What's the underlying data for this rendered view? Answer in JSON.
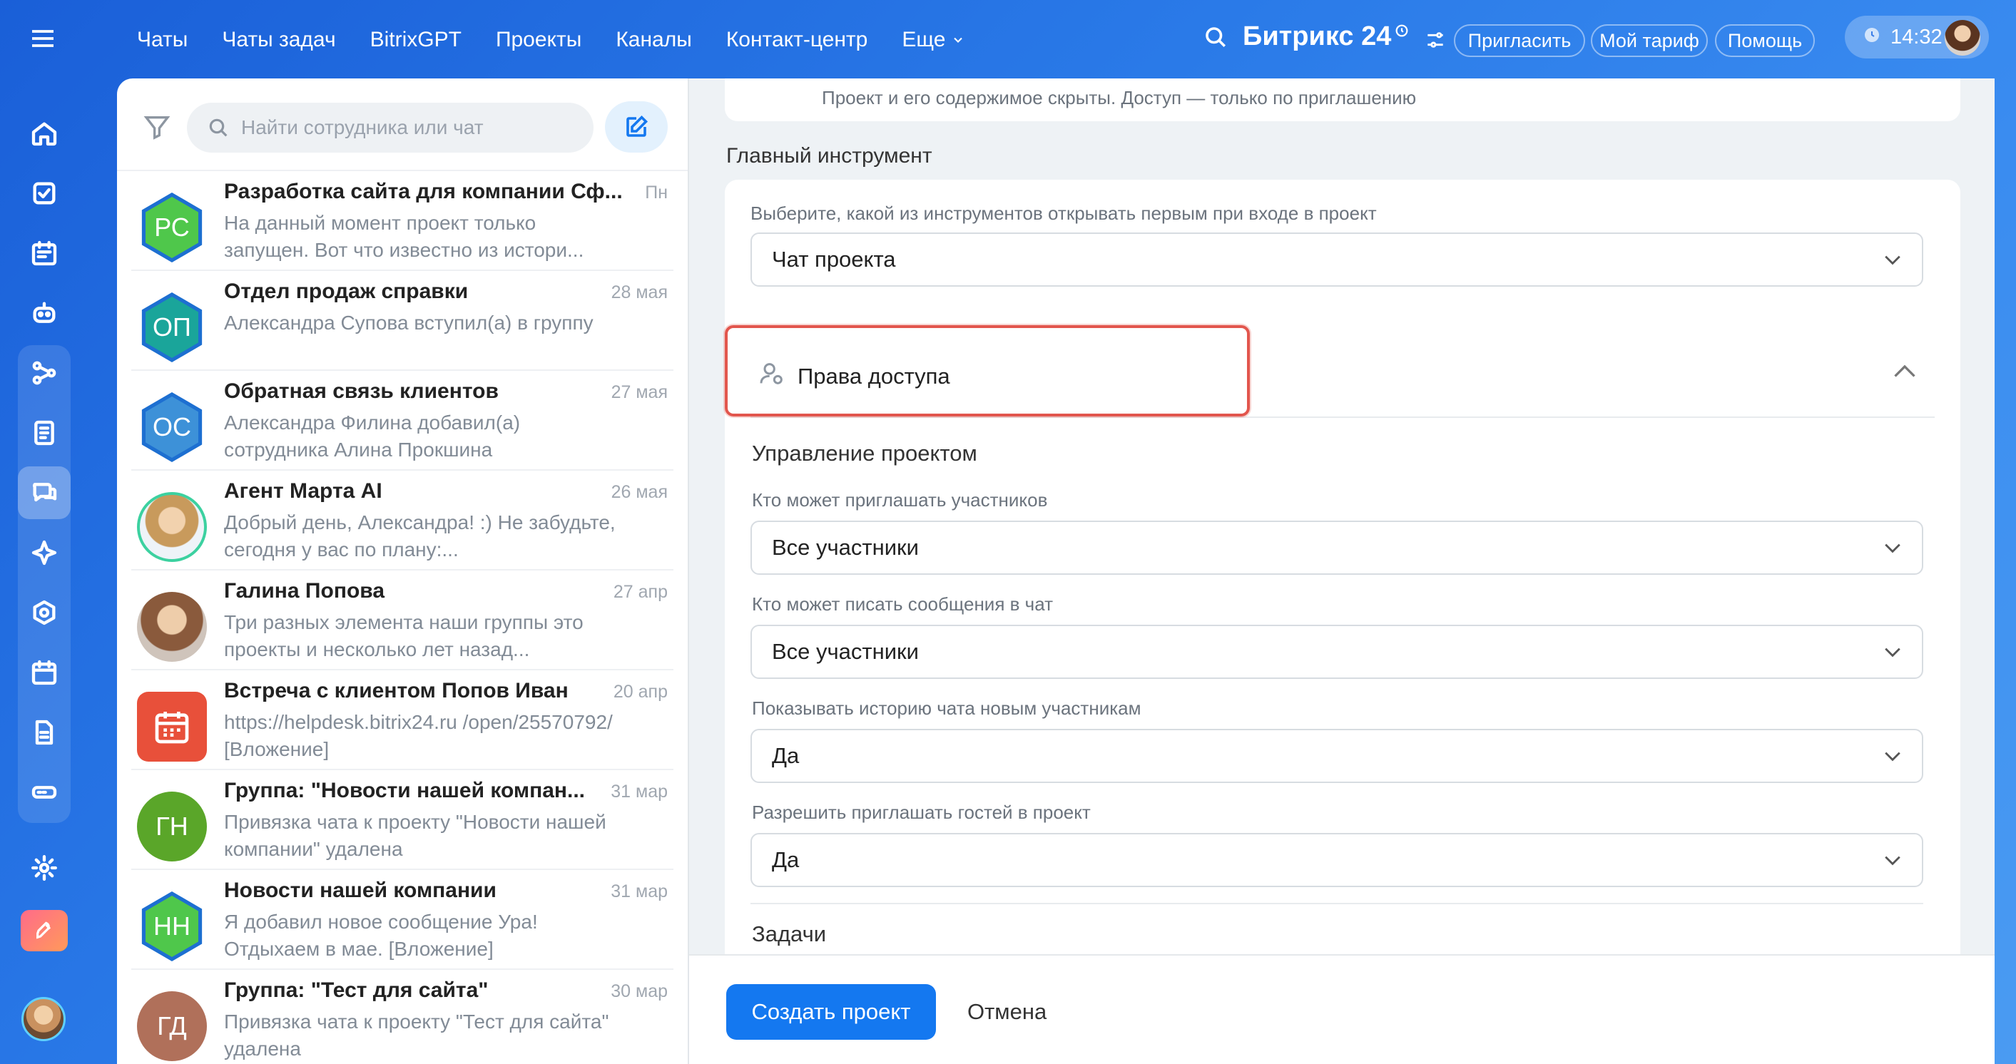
{
  "topbar": {
    "nav": [
      "Чаты",
      "Чаты задач",
      "BitrixGPT",
      "Проекты",
      "Каналы",
      "Контакт-центр",
      "Еще"
    ],
    "brand": "Битрикс 24",
    "invite_label": "Пригласить",
    "tariff_label": "Мой тариф",
    "help_label": "Помощь",
    "time": "14:32"
  },
  "chatlist": {
    "search_placeholder": "Найти сотрудника или чат",
    "items": [
      {
        "initials": "РС",
        "color": "#4fc74b",
        "shape": "hex",
        "title": "Разработка сайта для компании Сф...",
        "date": "Пн",
        "preview": "На данный момент проект только запущен. Вот что известно из истори..."
      },
      {
        "initials": "ОП",
        "color": "#1aa59a",
        "shape": "hex",
        "title": "Отдел продаж справки",
        "date": "28 мая",
        "preview": "Александра Супова вступил(а) в группу"
      },
      {
        "initials": "ОС",
        "color": "#3d91d8",
        "shape": "hex",
        "title": "Обратная связь клиентов",
        "date": "27 мая",
        "preview": "Александра Филина добавил(а) сотрудника Алина Прокшина"
      },
      {
        "initials": "",
        "color": "#c9a87d",
        "shape": "photo-ring",
        "title": "Агент Марта AI",
        "date": "26 мая",
        "preview": "Добрый день, Александра! :) Не забудьте, сегодня у вас по плану:..."
      },
      {
        "initials": "",
        "color": "#8a5a3c",
        "shape": "photo",
        "title": "Галина Попова",
        "date": "27 апр",
        "preview": "Три разных элемента наши группы это проекты и несколько лет назад..."
      },
      {
        "initials": "",
        "color": "#e8503a",
        "shape": "calendar",
        "title": "Встреча с клиентом Попов Иван",
        "date": "20 апр",
        "preview": "https://helpdesk.bitrix24.ru /open/25570792/ [Вложение]"
      },
      {
        "initials": "ГН",
        "color": "#5aa629",
        "shape": "circle",
        "title": "Группа: \"Новости нашей компан...",
        "date": "31 мар",
        "preview": "Привязка чата к проекту \"Новости нашей компании\" удалена"
      },
      {
        "initials": "НН",
        "color": "#4fc74b",
        "shape": "hex",
        "title": "Новости нашей компании",
        "date": "31 мар",
        "preview": "Я добавил новое сообщение Ура! Отдыхаем в мае. [Вложение]"
      },
      {
        "initials": "ГД",
        "color": "#b0705a",
        "shape": "circle",
        "title": "Группа: \"Тест для сайта\"",
        "date": "30 мар",
        "preview": "Привязка чата к проекту \"Тест для сайта\" удалена"
      }
    ]
  },
  "form": {
    "top_note": "Проект и его содержимое скрыты. Доступ — только по приглашению",
    "main_tool_heading": "Главный инструмент",
    "main_tool_hint": "Выберите, какой из инструментов открывать первым при входе в проект",
    "main_tool_value": "Чат проекта",
    "access_heading": "Права доступа",
    "manage_heading": "Управление проектом",
    "invite_label": "Кто может приглашать участников",
    "invite_value": "Все участники",
    "write_label": "Кто может писать сообщения в чат",
    "write_value": "Все участники",
    "history_label": "Показывать историю чата новым участникам",
    "history_value": "Да",
    "guests_label": "Разрешить приглашать гостей в проект",
    "guests_value": "Да",
    "tasks_heading": "Задачи",
    "create_label": "Создать проект",
    "cancel_label": "Отмена"
  },
  "colors": {
    "accent": "#1478f0",
    "highlight": "#e2564d"
  }
}
